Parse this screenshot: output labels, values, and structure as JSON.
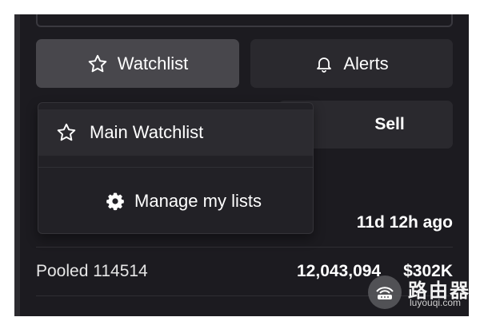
{
  "actions": {
    "watchlist_label": "Watchlist",
    "alerts_label": "Alerts",
    "sell_label": "Sell"
  },
  "dropdown": {
    "items": [
      {
        "label": "Main Watchlist",
        "icon": "star-icon"
      },
      {
        "label": "Manage my lists",
        "icon": "gear-icon"
      }
    ]
  },
  "activity": {
    "time_ago": "11d 12h ago"
  },
  "holders": [
    {
      "name": "Pooled 114514",
      "amount": "12,043,094",
      "value": "$302K"
    }
  ],
  "watermark": {
    "title": "路由器",
    "url": "luyouqi.com"
  },
  "colors": {
    "panel_bg": "#1c1b20",
    "button_active": "#48474c",
    "button_bg": "#2a292e",
    "dropdown_bg": "#222126",
    "text": "#ffffff"
  }
}
